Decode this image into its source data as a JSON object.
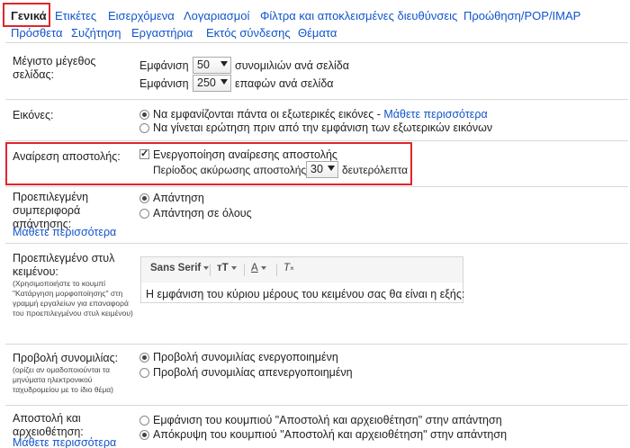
{
  "tabs_row1": [
    "Γενικά",
    "Ετικέτες",
    "Εισερχόμενα",
    "Λογαριασμοί",
    "Φίλτρα και αποκλεισμένες διευθύνσεις",
    "Προώθηση/POP/IMAP"
  ],
  "tabs_row2": [
    "Πρόσθετα",
    "Συζήτηση",
    "Εργαστήρια",
    "Εκτός σύνδεσης",
    "Θέματα"
  ],
  "max_page": {
    "label": "Μέγιστο μέγεθος σελίδας:",
    "show": "Εμφάνιση",
    "conv_value": "50",
    "conv_suffix": "συνομιλιών ανά σελίδα",
    "contacts_value": "250",
    "contacts_suffix": "επαφών ανά σελίδα"
  },
  "images": {
    "label": "Εικόνες:",
    "opt1": "Να εμφανίζονται πάντα οι εξωτερικές εικόνες",
    "opt1_dash": " - ",
    "opt1_link": "Μάθετε περισσότερα",
    "opt2": "Να γίνεται ερώτηση πριν από την εμφάνιση των εξωτερικών εικόνων"
  },
  "undo_send": {
    "label": "Αναίρεση αποστολής:",
    "checkbox": "Ενεργοποίηση αναίρεσης αποστολής",
    "period": "Περίοδος ακύρωσης αποστολής:",
    "value": "30",
    "unit": "δευτερόλεπτα"
  },
  "reply": {
    "label": "Προεπιλεγμένη συμπεριφορά απάντησης:",
    "link": "Μάθετε περισσότερα",
    "opt1": "Απάντηση",
    "opt2": "Απάντηση σε όλους"
  },
  "text_style": {
    "label": "Προεπιλεγμένο στυλ κειμένου:",
    "help": "(Χρησιμοποιήστε το κουμπί \"Κατάργηση μορφοποίησης\" στη γραμμή εργαλείων για επαναφορά του προεπιλεγμένου στυλ κειμένου)",
    "font": "Sans Serif",
    "size_glyph": "тT",
    "color_glyph": "A",
    "clear_glyph": "T",
    "preview": "Η εμφάνιση του κύριου μέρους του κειμένου σας θα είναι η εξής:"
  },
  "conv_view": {
    "label": "Προβολή συνομιλίας:",
    "help": "(ορίζει αν ομαδοποιούνται τα μηνύματα ηλεκτρονικού ταχυδρομείου με το ίδιο θέμα)",
    "opt1": "Προβολή συνομιλίας ενεργοποιημένη",
    "opt2": "Προβολή συνομιλίας απενεργοποιημένη"
  },
  "send_archive": {
    "label": "Αποστολή και αρχειοθέτηση:",
    "link": "Μάθετε περισσότερα",
    "opt1": "Εμφάνιση του κουμπιού \"Αποστολή και αρχειοθέτηση\" στην απάντηση",
    "opt2": "Απόκρυψη του κουμπιού \"Αποστολή και αρχειοθέτηση\" στην απάντηση"
  },
  "colors": {
    "link": "#1155cc",
    "highlight": "#e2252b"
  }
}
